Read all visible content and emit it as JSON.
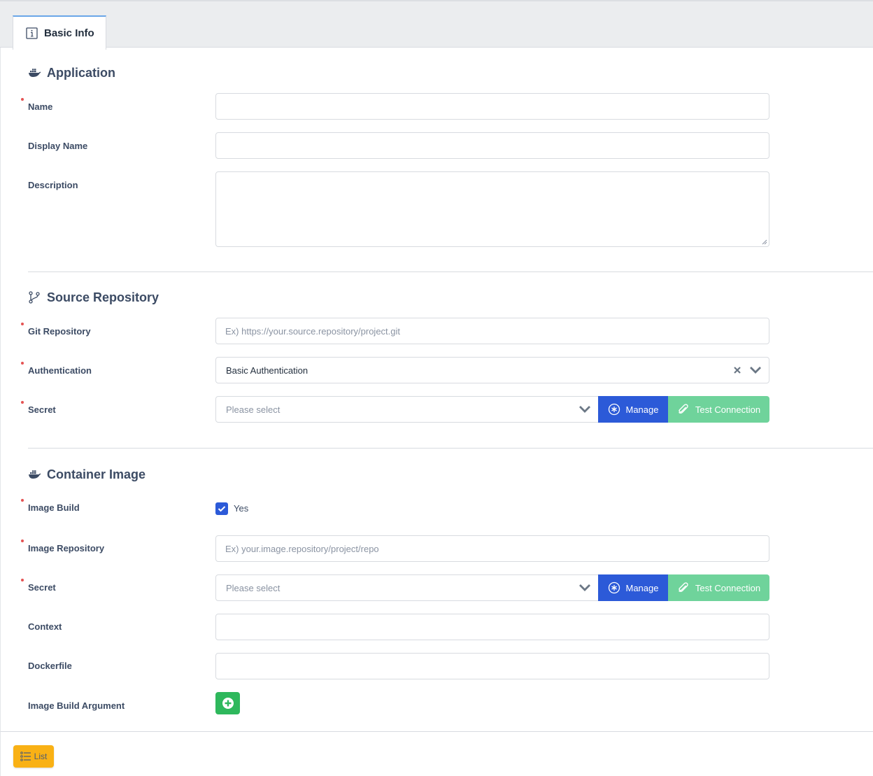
{
  "tabs": [
    {
      "label": "Basic Info",
      "icon": "info-icon",
      "active": true
    }
  ],
  "sections": {
    "application": {
      "title": "Application",
      "icon": "docker-icon",
      "fields": {
        "name": {
          "label": "Name",
          "value": "",
          "required": true
        },
        "display_name": {
          "label": "Display Name",
          "value": ""
        },
        "description": {
          "label": "Description",
          "value": ""
        }
      }
    },
    "source_repository": {
      "title": "Source Repository",
      "icon": "git-branch-icon",
      "fields": {
        "git_repository": {
          "label": "Git Repository",
          "placeholder": "Ex) https://your.source.repository/project.git",
          "required": true
        },
        "authentication": {
          "label": "Authentication",
          "value": "Basic Authentication",
          "required": true
        },
        "secret": {
          "label": "Secret",
          "placeholder": "Please select",
          "required": true
        }
      },
      "manage_label": "Manage",
      "test_label": "Test Connection"
    },
    "container_image": {
      "title": "Container Image",
      "icon": "docker-icon",
      "fields": {
        "image_build": {
          "label": "Image Build",
          "checkbox_label": "Yes",
          "checked": true,
          "required": true
        },
        "image_repository": {
          "label": "Image Repository",
          "placeholder": "Ex) your.image.repository/project/repo",
          "required": true
        },
        "secret": {
          "label": "Secret",
          "placeholder": "Please select",
          "required": true
        },
        "context": {
          "label": "Context",
          "value": ""
        },
        "dockerfile": {
          "label": "Dockerfile",
          "value": ""
        },
        "image_build_argument": {
          "label": "Image Build Argument"
        }
      },
      "manage_label": "Manage",
      "test_label": "Test Connection"
    }
  },
  "footer": {
    "list_label": "List"
  },
  "colors": {
    "primary": "#2c5ad8",
    "success": "#2eb85c",
    "success_light": "#6fd39b",
    "warning": "#f9b115",
    "required": "#e55353",
    "tab_accent": "#6aa6e8"
  }
}
